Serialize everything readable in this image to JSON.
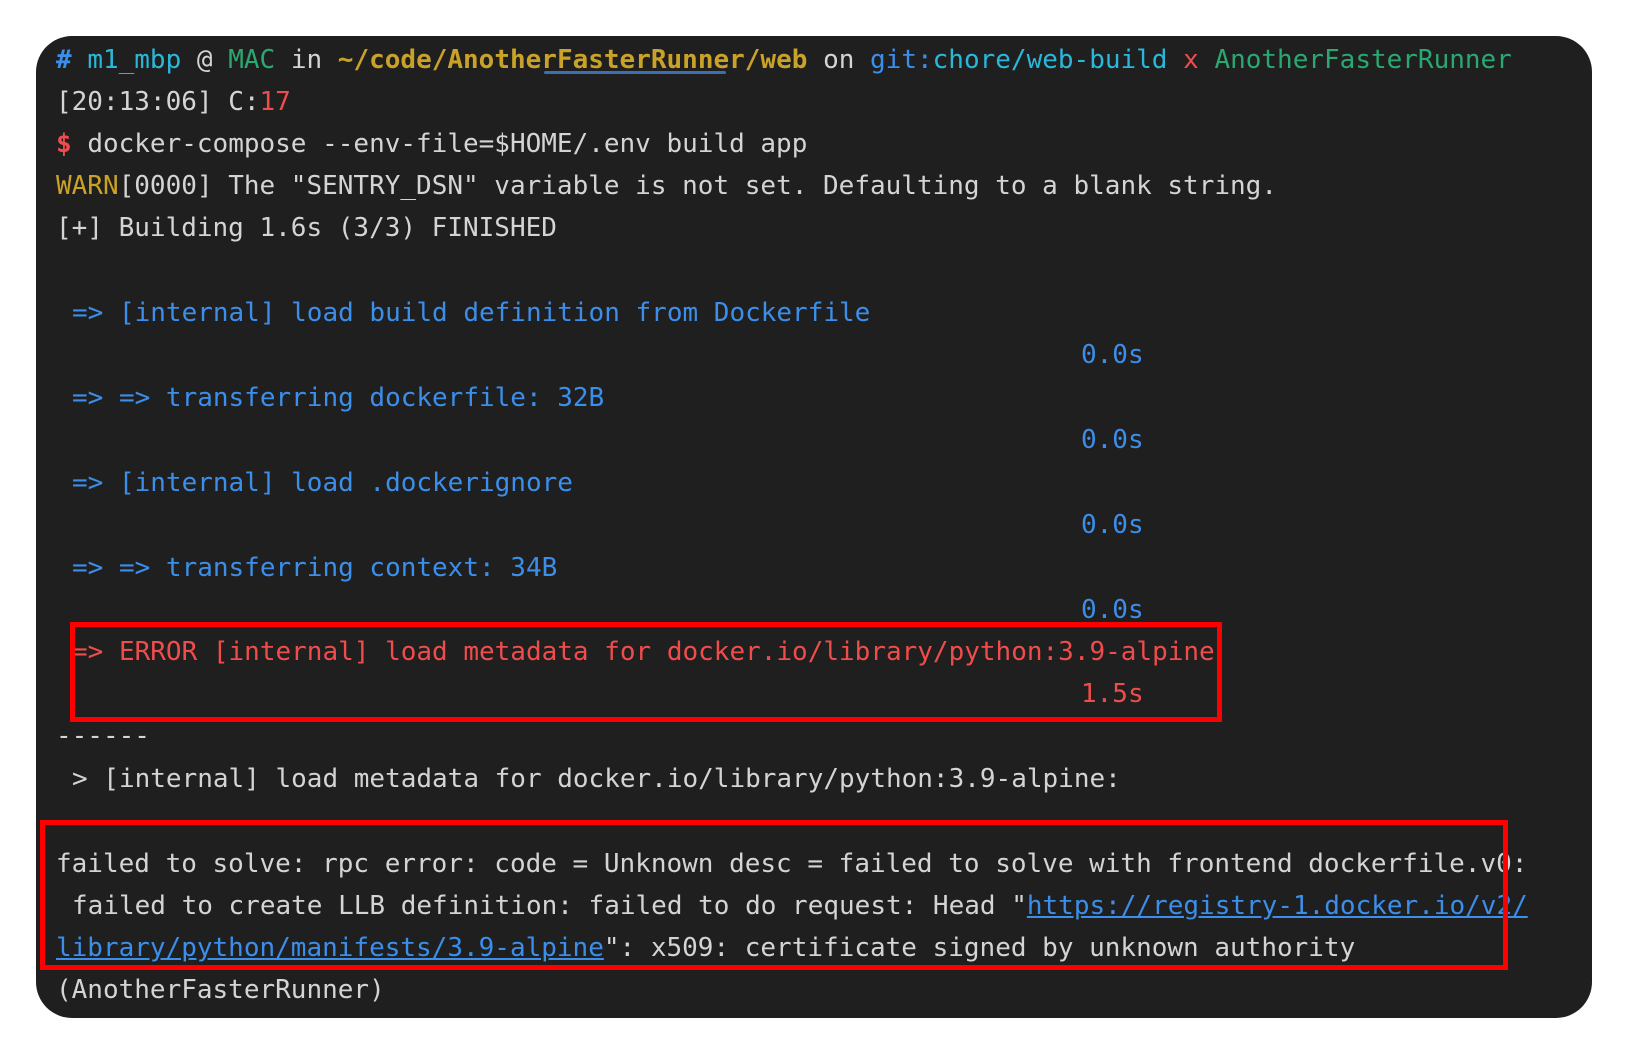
{
  "prompt": {
    "hash": "#",
    "user": "m1_mbp",
    "at": "@",
    "host": "MAC",
    "in": "in",
    "path": "~/code/AnotherFasterRunner/web",
    "on": "on",
    "git_label": "git:",
    "branch": "chore/web-build",
    "dirty_mark": "x",
    "venv": "AnotherFasterRunner",
    "time": "[20:13:06]",
    "code_label": "C:",
    "code_value": "17",
    "dollar": "$",
    "command": "docker-compose --env-file=$HOME/.env build app"
  },
  "output": {
    "warn_label": "WARN",
    "warn_text": "[0000] The \"SENTRY_DSN\" variable is not set. Defaulting to a blank string.",
    "building": "[+] Building 1.6s (3/3) FINISHED",
    "steps": [
      {
        "text": "=> [internal] load build definition from Dockerfile",
        "time": "0.0s"
      },
      {
        "text": "=> => transferring dockerfile: 32B",
        "time": "0.0s"
      },
      {
        "text": "=> [internal] load .dockerignore",
        "time": "0.0s"
      },
      {
        "text": "=> => transferring context: 34B",
        "time": "0.0s"
      },
      {
        "text": "=> ERROR [internal] load metadata for docker.io/library/python:3.9-alpine",
        "time": "1.5s"
      }
    ],
    "separator": "------",
    "metadata_line": "> [internal] load metadata for docker.io/library/python:3.9-alpine:",
    "error_line1": "failed to solve: rpc error: code = Unknown desc = failed to solve with frontend dockerfile.v0:",
    "error_line2_prefix": "failed to create LLB definition: failed to do request: Head \"",
    "error_link_part1": "https://registry-1.docker.io/v2/",
    "error_link_part2": "library/python/manifests/3.9-alpine",
    "error_line3_suffix": "\": x509: certificate signed by unknown authority",
    "partial_next_prompt": "(AnotherFasterRunner)"
  },
  "colors": {
    "background": "#1f1f1f",
    "blue": "#3b8eea",
    "red": "#f14c4c",
    "highlight_box": "#ff0000"
  }
}
